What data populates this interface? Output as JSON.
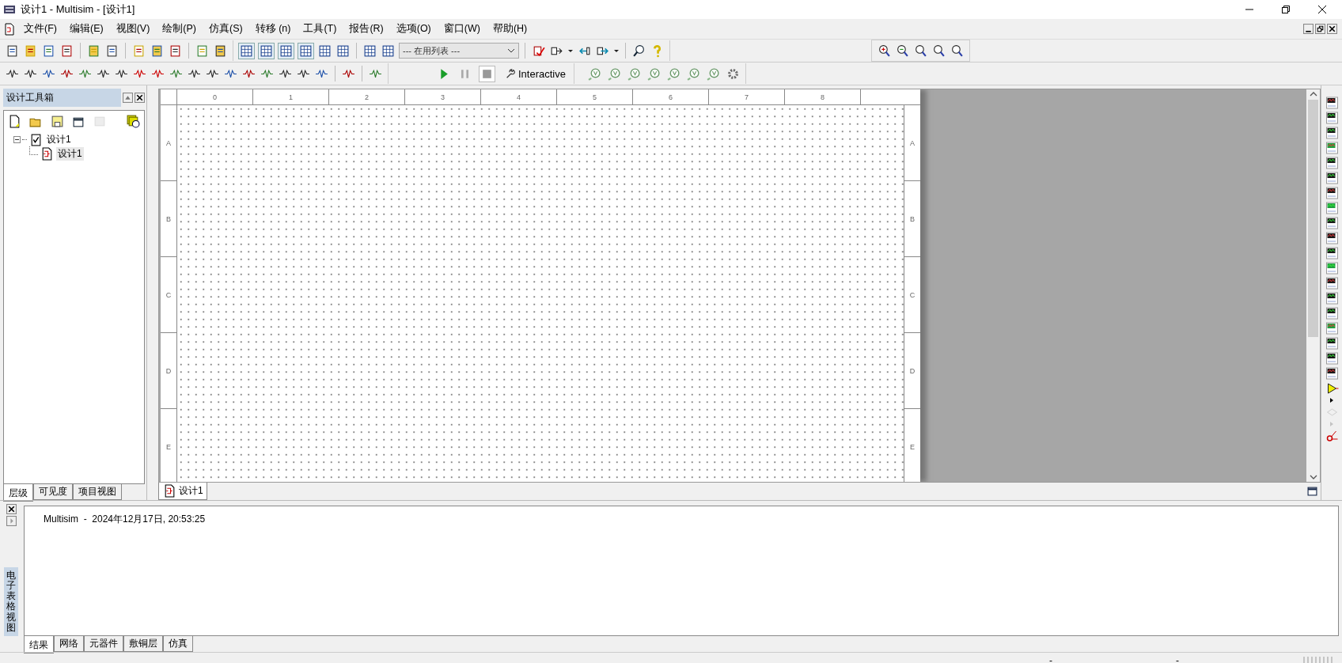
{
  "window": {
    "title": "设计1 - Multisim - [设计1]"
  },
  "menu": [
    {
      "label": "文件(F)"
    },
    {
      "label": "编辑(E)"
    },
    {
      "label": "视图(V)"
    },
    {
      "label": "绘制(P)"
    },
    {
      "label": "仿真(S)"
    },
    {
      "label": "转移 (n)"
    },
    {
      "label": "工具(T)"
    },
    {
      "label": "报告(R)"
    },
    {
      "label": "选项(O)"
    },
    {
      "label": "窗口(W)"
    },
    {
      "label": "帮助(H)"
    }
  ],
  "toolbar": {
    "component_list": {
      "value": "--- 在用列表 ---"
    },
    "simulation": {
      "mode": "Interactive"
    }
  },
  "design_toolbox": {
    "title": "设计工具箱",
    "tree": [
      {
        "label": "设计1",
        "expanded": true,
        "children": [
          {
            "label": "设计1",
            "selected": true
          }
        ]
      }
    ],
    "tabs": [
      {
        "label": "层级",
        "selected": true
      },
      {
        "label": "可见度",
        "selected": false
      },
      {
        "label": "项目视图",
        "selected": false
      }
    ]
  },
  "sheet": {
    "columns": [
      "0",
      "1",
      "2",
      "3",
      "4",
      "5",
      "6",
      "7",
      "8"
    ],
    "rows_left": [
      "A",
      "B",
      "C",
      "D",
      "E"
    ],
    "rows_right": [
      "A",
      "B",
      "C",
      "D",
      "E"
    ]
  },
  "document_tabs": [
    {
      "label": "设计1",
      "selected": true
    }
  ],
  "spreadsheet_view": {
    "title": "电子表格视图",
    "messages": [
      "Multisim  -  2024年12月17日, 20:53:25"
    ],
    "tabs": [
      {
        "label": "结果",
        "selected": true
      },
      {
        "label": "网络",
        "selected": false
      },
      {
        "label": "元器件",
        "selected": false
      },
      {
        "label": "敷铜层",
        "selected": false
      },
      {
        "label": "仿真",
        "selected": false
      }
    ]
  },
  "status_bar": [
    "-",
    "-"
  ]
}
